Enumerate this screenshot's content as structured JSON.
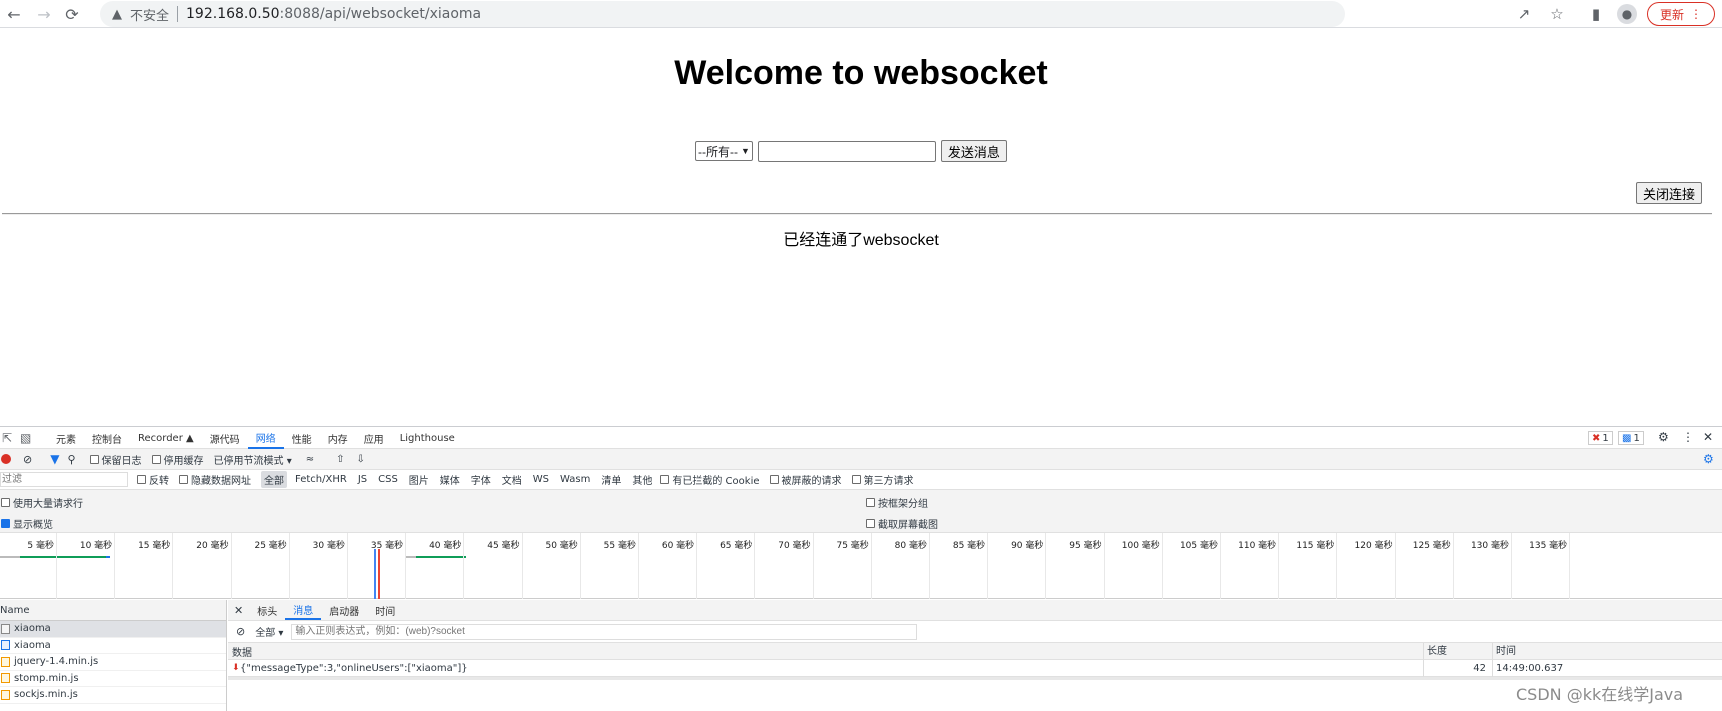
{
  "browser": {
    "insecure_label": "不安全",
    "url_host": "192.168.0.50",
    "url_path": ":8088/api/websocket/xiaoma",
    "update_label": "更新"
  },
  "page": {
    "title": "Welcome to websocket",
    "select_value": "--所有--",
    "input_value": "",
    "send_label": "发送消息",
    "close_label": "关闭连接",
    "status_text": "已经连通了websocket"
  },
  "devtools": {
    "tabs": [
      "元素",
      "控制台",
      "Recorder ▲",
      "源代码",
      "网络",
      "性能",
      "内存",
      "应用",
      "Lighthouse"
    ],
    "active_tab": 4,
    "error_count": "1",
    "message_count": "1",
    "toolbar": {
      "preserve_log": "保留日志",
      "disable_cache": "停用缓存",
      "throttle": "已停用节流模式"
    },
    "filter": {
      "placeholder": "过滤",
      "invert": "反转",
      "hide_data_urls": "隐藏数据网址",
      "types": [
        "全部",
        "Fetch/XHR",
        "JS",
        "CSS",
        "图片",
        "媒体",
        "字体",
        "文档",
        "WS",
        "Wasm",
        "清单",
        "其他"
      ],
      "blocked_cookies": "有已拦截的 Cookie",
      "blocked_requests": "被屏蔽的请求",
      "third_party": "第三方请求"
    },
    "options": {
      "large_rows": "使用大量请求行",
      "group_by_frame": "按框架分组",
      "show_overview": "显示概览",
      "capture_screenshots": "截取屏幕截图"
    },
    "timeline_ticks": [
      "5 毫秒",
      "10 毫秒",
      "15 毫秒",
      "20 毫秒",
      "25 毫秒",
      "30 毫秒",
      "35 毫秒",
      "40 毫秒",
      "45 毫秒",
      "50 毫秒",
      "55 毫秒",
      "60 毫秒",
      "65 毫秒",
      "70 毫秒",
      "75 毫秒",
      "80 毫秒",
      "85 毫秒",
      "90 毫秒",
      "95 毫秒",
      "100 毫秒",
      "105 毫秒",
      "110 毫秒",
      "115 毫秒",
      "120 毫秒",
      "125 毫秒",
      "130 毫秒",
      "135 毫秒"
    ],
    "requests_header": "Name",
    "requests": [
      {
        "name": "xiaoma",
        "icon": "websocket-icon"
      },
      {
        "name": "xiaoma",
        "icon": "document-icon"
      },
      {
        "name": "jquery-1.4.min.js",
        "icon": "script-icon"
      },
      {
        "name": "stomp.min.js",
        "icon": "script-icon"
      },
      {
        "name": "sockjs.min.js",
        "icon": "script-icon"
      }
    ],
    "detail_tabs": [
      "标头",
      "消息",
      "启动器",
      "时间"
    ],
    "active_detail_tab": 1,
    "message_filter_type": "全部",
    "message_filter_placeholder": "输入正则表达式，例如：(web)?socket",
    "columns": {
      "data": "数据",
      "length": "长度",
      "time": "时间"
    },
    "messages": [
      {
        "data": "{\"messageType\":3,\"onlineUsers\":[\"xiaoma\"]}",
        "length": "42",
        "time": "14:49:00.637"
      }
    ]
  },
  "watermark": "CSDN @kk在线学Java",
  "colors": {
    "accent": "#1a73e8",
    "record": "#d93025",
    "update_border": "#d93025"
  }
}
